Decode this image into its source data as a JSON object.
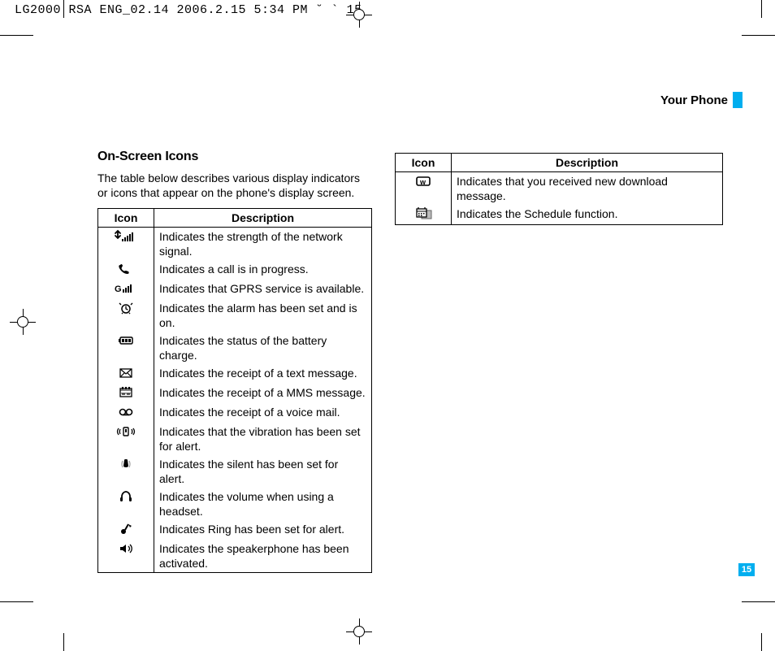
{
  "header_line": "LG2000 RSA ENG_02.14  2006.2.15 5:34 PM  ˘   ` 15",
  "section_title": "Your Phone",
  "page_number": "15",
  "left_column": {
    "heading": "On-Screen Icons",
    "intro": "The table below describes various display indicators or icons that appear on the phone's display screen.",
    "headers": {
      "icon": "Icon",
      "description": "Description"
    },
    "rows": [
      {
        "icon": "signal-strength-icon",
        "desc": "Indicates the strength of the network signal."
      },
      {
        "icon": "call-in-progress-icon",
        "desc": "Indicates a call is in progress."
      },
      {
        "icon": "gprs-icon",
        "desc": "Indicates that GPRS service is available."
      },
      {
        "icon": "alarm-icon",
        "desc": "Indicates the alarm has been set and is on."
      },
      {
        "icon": "battery-icon",
        "desc": "Indicates the status of the battery charge."
      },
      {
        "icon": "text-message-icon",
        "desc": "Indicates the receipt of a text message."
      },
      {
        "icon": "mms-message-icon",
        "desc": "Indicates the receipt of a MMS message."
      },
      {
        "icon": "voicemail-icon",
        "desc": "Indicates the receipt of a voice mail."
      },
      {
        "icon": "vibrate-icon",
        "desc": "Indicates that the vibration has been set for alert."
      },
      {
        "icon": "silent-icon",
        "desc": "Indicates the silent has been set for alert."
      },
      {
        "icon": "headset-icon",
        "desc": "Indicates the volume when using a headset."
      },
      {
        "icon": "ring-icon",
        "desc": "Indicates Ring has been set for alert."
      },
      {
        "icon": "speakerphone-icon",
        "desc": "Indicates the speakerphone has been activated."
      }
    ]
  },
  "right_column": {
    "headers": {
      "icon": "Icon",
      "description": "Description"
    },
    "rows": [
      {
        "icon": "download-message-icon",
        "desc": "Indicates that you received new download message."
      },
      {
        "icon": "schedule-icon",
        "desc": "Indicates the Schedule function."
      }
    ]
  }
}
